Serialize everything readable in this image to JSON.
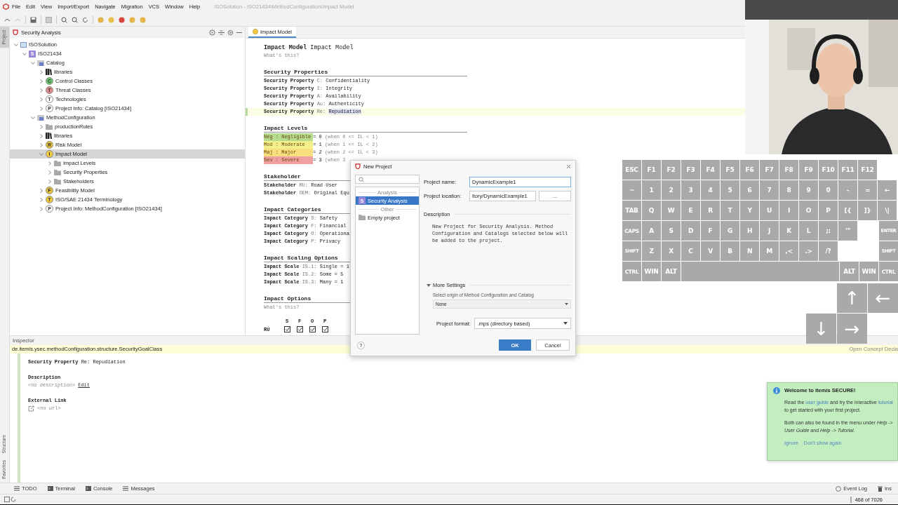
{
  "menu_bar": {
    "items": [
      {
        "label": "File"
      },
      {
        "label": "Edit"
      },
      {
        "label": "View"
      },
      {
        "label": "Import/Export"
      },
      {
        "label": "Navigate"
      },
      {
        "label": "Migration"
      },
      {
        "label": "VCS"
      },
      {
        "label": "Window"
      },
      {
        "label": "Help"
      }
    ],
    "title": "ISOSolution - ISO21434\\MethodConfiguration\\Impact Model"
  },
  "side_stripe": {
    "top_tabs": [
      {
        "label": "Project",
        "selected": true
      }
    ],
    "bottom_tabs": [
      {
        "label": "Structure",
        "selected": false
      },
      {
        "label": "Favorites",
        "selected": false
      }
    ]
  },
  "project_panel": {
    "title": "Security Analysis",
    "tree": [
      {
        "label": "ISOSolution",
        "kind": "solution",
        "expanded": true,
        "selected": false,
        "children": [
          {
            "label": "ISO21434",
            "kind": "module",
            "badge": "S",
            "expanded": true,
            "selected": false,
            "children": [
              {
                "label": "Catalog",
                "kind": "model",
                "expanded": true,
                "selected": false,
                "children": [
                  {
                    "label": "libraries",
                    "kind": "library",
                    "expanded": false,
                    "selected": false
                  },
                  {
                    "label": "Control Classes",
                    "kind": "concept",
                    "badge": "C",
                    "color": "#6cc66c",
                    "expanded": false,
                    "selected": false
                  },
                  {
                    "label": "Threat Classes",
                    "kind": "concept",
                    "badge": "T",
                    "color": "#e48a8a",
                    "expanded": false,
                    "selected": false
                  },
                  {
                    "label": "Technologies",
                    "kind": "concept",
                    "badge": "T",
                    "color": "#ffffff",
                    "expanded": false,
                    "selected": false
                  },
                  {
                    "label": "Project Info: Catalog [ISO21434]",
                    "kind": "concept",
                    "badge": "P",
                    "color": "#fdfdfd",
                    "expanded": false,
                    "selected": false
                  }
                ]
              },
              {
                "label": "MethodConfiguration",
                "kind": "model",
                "expanded": true,
                "selected": false,
                "children": [
                  {
                    "label": "productionRules",
                    "kind": "folder",
                    "expanded": false,
                    "selected": false
                  },
                  {
                    "label": "libraries",
                    "kind": "library",
                    "expanded": false,
                    "selected": false
                  },
                  {
                    "label": "Risk Model",
                    "kind": "concept",
                    "badge": "R",
                    "color": "#e8c43c",
                    "expanded": false,
                    "selected": false
                  },
                  {
                    "label": "Impact Model",
                    "kind": "concept",
                    "badge": "I",
                    "color": "#f0cc44",
                    "expanded": true,
                    "selected": true,
                    "children": [
                      {
                        "label": "Impact Levels",
                        "kind": "folder",
                        "expanded": false,
                        "selected": false
                      },
                      {
                        "label": "Security Properties",
                        "kind": "folder",
                        "expanded": false,
                        "selected": false
                      },
                      {
                        "label": "Stakeholders",
                        "kind": "folder",
                        "expanded": false,
                        "selected": false
                      }
                    ]
                  },
                  {
                    "label": "Feasibility Model",
                    "kind": "concept",
                    "badge": "F",
                    "color": "#e6c040",
                    "expanded": false,
                    "selected": false
                  },
                  {
                    "label": "ISO/SAE 21434 Terminology",
                    "kind": "concept",
                    "badge": "T",
                    "color": "#ecc83e",
                    "expanded": false,
                    "selected": false
                  },
                  {
                    "label": "Project Info: MethodConfiguration [ISO21434]",
                    "kind": "concept",
                    "badge": "P",
                    "color": "#fbfbfb",
                    "expanded": false,
                    "selected": false
                  }
                ]
              }
            ]
          }
        ]
      }
    ]
  },
  "editor": {
    "tab": {
      "label": "Impact Model",
      "selected": true
    },
    "header": {
      "keyword": "Impact Model",
      "name": "Impact Model",
      "hint": "What's this?"
    },
    "sections": [
      {
        "heading": "Security Properties",
        "kind": "entries",
        "lines": [
          {
            "keyword": "Security Property",
            "id": "C:",
            "name": "Confidentiality",
            "selected": false
          },
          {
            "keyword": "Security Property",
            "id": "I:",
            "name": "Integrity",
            "selected": false
          },
          {
            "keyword": "Security Property",
            "id": "A:",
            "name": "Availability",
            "selected": false
          },
          {
            "keyword": "Security Property",
            "id": "Au:",
            "name": "Authenticity",
            "selected": false
          },
          {
            "keyword": "Security Property",
            "id": "Re:",
            "name": "Repudiation",
            "selected": true
          }
        ]
      },
      {
        "heading": "Impact Levels",
        "kind": "levels",
        "lines": [
          {
            "label": "Neg : Negligible",
            "color": "#b5dc8c",
            "value": "= 0",
            "condition": "(when 0 <= IL < 1)"
          },
          {
            "label": "Mod : Moderate",
            "color": "#f3f08c",
            "value": "= 1",
            "condition": "(when 1 <= IL < 2)"
          },
          {
            "label": "Maj : Major",
            "color": "#f6df7c",
            "value": "= 2",
            "condition": "(when 2 <= IL < 3)"
          },
          {
            "label": "Sev : Severe",
            "color": "#f0a0a0",
            "value": "= 3",
            "condition": "(when 3"
          }
        ]
      },
      {
        "heading": "Stakeholder",
        "kind": "entries",
        "lines": [
          {
            "keyword": "Stakeholder",
            "id": "RU:",
            "name": "Road User",
            "selected": false
          },
          {
            "keyword": "Stakeholder",
            "id": "OEM:",
            "name": "Original Equ",
            "selected": false
          }
        ]
      },
      {
        "heading": "Impact Categories",
        "kind": "entries",
        "lines": [
          {
            "keyword": "Impact Category",
            "id": "S:",
            "name": "Safety",
            "selected": false
          },
          {
            "keyword": "Impact Category",
            "id": "F:",
            "name": "Financial",
            "selected": false
          },
          {
            "keyword": "Impact Category",
            "id": "O:",
            "name": "Operationa",
            "selected": false
          },
          {
            "keyword": "Impact Category",
            "id": "P:",
            "name": "Privacy",
            "selected": false
          }
        ]
      },
      {
        "heading": "Impact Scaling Options",
        "kind": "entries",
        "lines": [
          {
            "keyword": "Impact Scale",
            "id": "IS.1:",
            "name": "Single",
            "value": "= 1",
            "selected": false
          },
          {
            "keyword": "Impact Scale",
            "id": "IS.2:",
            "name": "Some",
            "value": "= 5",
            "selected": false
          },
          {
            "keyword": "Impact Scale",
            "id": "IS.3:",
            "name": "Many",
            "value": "= 1",
            "selected": false
          }
        ]
      }
    ],
    "options": {
      "heading": "Impact Options",
      "hint": "What's this?",
      "columns": [
        "S",
        "F",
        "O",
        "P"
      ],
      "rows": [
        {
          "label": "RU",
          "checks": [
            {
              "checked": true
            },
            {
              "checked": true
            },
            {
              "checked": true
            },
            {
              "checked": true
            }
          ]
        }
      ]
    }
  },
  "inspector": {
    "title": "Inspector",
    "concept": "de.itemis.ysec.methodConfiguration.structure.SecurityGoalClass",
    "action": "Open Concept Decla",
    "keyword": "Security Property",
    "name": "Re: Repudiation",
    "description_label": "Description",
    "description": "<no description>",
    "edit_link": "Edit",
    "link_label": "External Link",
    "url": "<no url>"
  },
  "tool_tabs": {
    "left": [
      {
        "label": "TODO",
        "kind": "list"
      },
      {
        "label": "Terminal",
        "kind": "terminal"
      },
      {
        "label": "Console",
        "kind": "terminal"
      },
      {
        "label": "Messages",
        "kind": "list"
      }
    ],
    "right": [
      {
        "label": "Event Log",
        "kind": "bubble"
      },
      {
        "label": "Ins",
        "kind": "trash"
      }
    ]
  },
  "status_bar": {
    "position": "468 of 7026"
  },
  "keyboard": {
    "rows": [
      {
        "keys": [
          {
            "kind": "key",
            "label": "ESC"
          },
          {
            "kind": "key",
            "label": "F1"
          },
          {
            "kind": "key",
            "label": "F2"
          },
          {
            "kind": "key",
            "label": "F3"
          },
          {
            "kind": "key",
            "label": "F4"
          },
          {
            "kind": "key",
            "label": "F5"
          },
          {
            "kind": "key",
            "label": "F6"
          },
          {
            "kind": "key",
            "label": "F7"
          },
          {
            "kind": "key",
            "label": "F8"
          },
          {
            "kind": "key",
            "label": "F9"
          },
          {
            "kind": "key",
            "label": "F10"
          },
          {
            "kind": "key",
            "label": "F11"
          },
          {
            "kind": "key",
            "label": "F12"
          }
        ]
      },
      {
        "keys": [
          {
            "kind": "key",
            "label": "~"
          },
          {
            "kind": "key",
            "label": "1"
          },
          {
            "kind": "key",
            "label": "2"
          },
          {
            "kind": "key",
            "label": "3"
          },
          {
            "kind": "key",
            "label": "4"
          },
          {
            "kind": "key",
            "label": "5"
          },
          {
            "kind": "key",
            "label": "6"
          },
          {
            "kind": "key",
            "label": "7"
          },
          {
            "kind": "key",
            "label": "8"
          },
          {
            "kind": "key",
            "label": "9"
          },
          {
            "kind": "key",
            "label": "0"
          },
          {
            "kind": "key",
            "label": "-"
          },
          {
            "kind": "key",
            "label": "="
          },
          {
            "kind": "key",
            "label": "←"
          }
        ]
      },
      {
        "keys": [
          {
            "kind": "key",
            "label": "TAB"
          },
          {
            "kind": "key",
            "label": "Q"
          },
          {
            "kind": "key",
            "label": "W"
          },
          {
            "kind": "key",
            "label": "E"
          },
          {
            "kind": "key",
            "label": "R"
          },
          {
            "kind": "key",
            "label": "T"
          },
          {
            "kind": "key",
            "label": "Y"
          },
          {
            "kind": "key",
            "label": "U"
          },
          {
            "kind": "key",
            "label": "I"
          },
          {
            "kind": "key",
            "label": "O"
          },
          {
            "kind": "key",
            "label": "P"
          },
          {
            "kind": "key",
            "label": "[{"
          },
          {
            "kind": "key",
            "label": "]}"
          },
          {
            "kind": "key",
            "label": "\\|"
          }
        ]
      },
      {
        "keys": [
          {
            "kind": "key",
            "label": "CAPS"
          },
          {
            "kind": "key",
            "label": "A"
          },
          {
            "kind": "key",
            "label": "S"
          },
          {
            "kind": "key",
            "label": "D"
          },
          {
            "kind": "key",
            "label": "F"
          },
          {
            "kind": "key",
            "label": "G"
          },
          {
            "kind": "key",
            "label": "H"
          },
          {
            "kind": "key",
            "label": "J"
          },
          {
            "kind": "key",
            "label": "K"
          },
          {
            "kind": "key",
            "label": "L"
          },
          {
            "kind": "key",
            "label": ";:"
          },
          {
            "kind": "key",
            "label": "'\""
          }
        ],
        "end": [
          {
            "kind": "key",
            "label": "ENTER"
          }
        ]
      },
      {
        "keys": [
          {
            "kind": "key",
            "label": "SHIFT"
          },
          {
            "kind": "key",
            "label": "Z"
          },
          {
            "kind": "key",
            "label": "X"
          },
          {
            "kind": "key",
            "label": "C"
          },
          {
            "kind": "key",
            "label": "V"
          },
          {
            "kind": "key",
            "label": "B"
          },
          {
            "kind": "key",
            "label": "N"
          },
          {
            "kind": "key",
            "label": "M"
          },
          {
            "kind": "key",
            "label": ",<"
          },
          {
            "kind": "key",
            "label": ".>"
          },
          {
            "kind": "key",
            "label": "/?"
          }
        ],
        "end": [
          {
            "kind": "key",
            "label": "SHIFT"
          }
        ]
      },
      {
        "keys": [
          {
            "kind": "key",
            "label": "CTRL"
          },
          {
            "kind": "key",
            "label": "WIN"
          },
          {
            "kind": "key",
            "label": "ALT"
          },
          {
            "kind": "space"
          },
          {
            "kind": "key",
            "label": "ALT"
          },
          {
            "kind": "key",
            "label": "WIN"
          },
          {
            "kind": "key",
            "label": "CTRL"
          }
        ]
      }
    ],
    "arrows": [
      {
        "label": "↑"
      },
      {
        "label": "←"
      },
      {
        "label": "↓"
      },
      {
        "label": "→"
      }
    ]
  },
  "dialog": {
    "title": "New Project",
    "groups": [
      {
        "heading": "Analysis",
        "items": [
          {
            "label": "Security Analysis",
            "kind": "module",
            "badge": "S",
            "selected": true
          }
        ]
      },
      {
        "heading": "Other",
        "items": [
          {
            "label": "Empty project",
            "kind": "folder",
            "selected": false
          }
        ]
      }
    ],
    "fields": [
      {
        "label": "Project name:",
        "value": "DynamicExample1",
        "focused": true
      },
      {
        "label": "Project location:",
        "value": "itory/DynamicExample1",
        "focused": false,
        "browse": "..."
      }
    ],
    "description_label": "Description",
    "description": "New Project for Security Analysis. Method Configuration and Catalogs selected below will be added to the project.",
    "more_settings": {
      "label": "More Settings",
      "expanded": true,
      "origin_label": "Select origin of Method Configuration and Catalog",
      "origin": "None"
    },
    "format_label": "Project format:",
    "format": ".mps (directory based)",
    "help": "?",
    "ok": "OK",
    "cancel": "Cancel"
  },
  "notification": {
    "title": "Welcome to itemis SECURE!",
    "paragraphs": [
      {
        "parts": [
          {
            "text": "Read the ",
            "link": false
          },
          {
            "text": "user guide",
            "link": true
          },
          {
            "text": " and try the interactive ",
            "link": false
          },
          {
            "text": "tutorial",
            "link": true
          },
          {
            "text": " to get started with your first project.",
            "link": false
          }
        ]
      },
      {
        "parts": [
          {
            "text": "Both can also be found in the menu under *Help -> User Guide* and *Help -> Tutorial*.",
            "link": false
          }
        ]
      }
    ],
    "actions": [
      {
        "label": "Ignore"
      },
      {
        "label": "Don't show again"
      }
    ]
  }
}
